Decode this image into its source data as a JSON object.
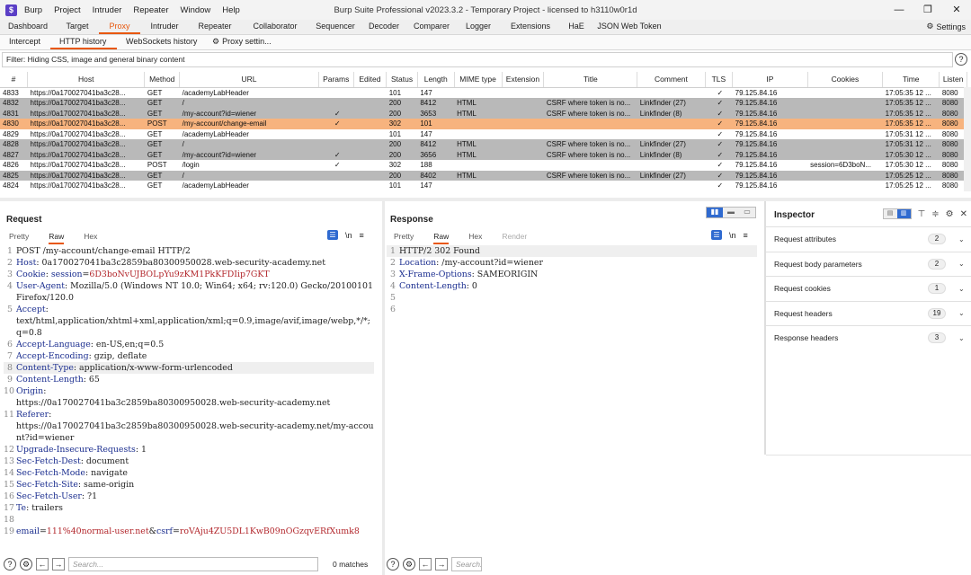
{
  "app": {
    "icon_letter": "$",
    "menu": [
      "Burp",
      "Project",
      "Intruder",
      "Repeater",
      "Window",
      "Help"
    ],
    "window_title": "Burp Suite Professional v2023.3.2 - Temporary Project - licensed to h3110w0r1d"
  },
  "main_tabs": [
    "Dashboard",
    "Target",
    "Proxy",
    "Intruder",
    "Repeater",
    "Collaborator",
    "Sequencer",
    "Decoder",
    "Comparer",
    "Logger",
    "Extensions",
    "HaE",
    "JSON Web Token"
  ],
  "main_tabs_active": "Proxy",
  "settings_label": "Settings",
  "proxy_tabs": [
    "Intercept",
    "HTTP history",
    "WebSockets history"
  ],
  "proxy_settings_label": "Proxy settin...",
  "filter_text": "Filter: Hiding CSS, image and general binary content",
  "history": {
    "columns": [
      "#",
      "Host",
      "Method",
      "URL",
      "Params",
      "Edited",
      "Status",
      "Length",
      "MIME type",
      "Extension",
      "Title",
      "Comment",
      "TLS",
      "IP",
      "Cookies",
      "Time",
      "Listen"
    ],
    "rows": [
      {
        "n": "4833",
        "host": "https://0a170027041ba3c28...",
        "method": "GET",
        "url": "/academyLabHeader",
        "params": "",
        "status": "101",
        "length": "147",
        "mime": "",
        "title": "",
        "comment": "",
        "tls": "✓",
        "ip": "79.125.84.16",
        "cookies": "",
        "time": "17:05:35 12 ...",
        "listen": "8080",
        "style": "white"
      },
      {
        "n": "4832",
        "host": "https://0a170027041ba3c28...",
        "method": "GET",
        "url": "/",
        "params": "",
        "status": "200",
        "length": "8412",
        "mime": "HTML",
        "title": "CSRF where token is no...",
        "comment": "Linkfinder (27)",
        "tls": "✓",
        "ip": "79.125.84.16",
        "cookies": "",
        "time": "17:05:35 12 ...",
        "listen": "8080",
        "style": "gray"
      },
      {
        "n": "4831",
        "host": "https://0a170027041ba3c28...",
        "method": "GET",
        "url": "/my-account?id=wiener",
        "params": "✓",
        "status": "200",
        "length": "3653",
        "mime": "HTML",
        "title": "CSRF where token is no...",
        "comment": "Linkfinder (8)",
        "tls": "✓",
        "ip": "79.125.84.16",
        "cookies": "",
        "time": "17:05:35 12 ...",
        "listen": "8080",
        "style": "gray"
      },
      {
        "n": "4830",
        "host": "https://0a170027041ba3c28...",
        "method": "POST",
        "url": "/my-account/change-email",
        "params": "✓",
        "status": "302",
        "length": "101",
        "mime": "",
        "title": "",
        "comment": "",
        "tls": "✓",
        "ip": "79.125.84.16",
        "cookies": "",
        "time": "17:05:35 12 ...",
        "listen": "8080",
        "style": "sel"
      },
      {
        "n": "4829",
        "host": "https://0a170027041ba3c28...",
        "method": "GET",
        "url": "/academyLabHeader",
        "params": "",
        "status": "101",
        "length": "147",
        "mime": "",
        "title": "",
        "comment": "",
        "tls": "✓",
        "ip": "79.125.84.16",
        "cookies": "",
        "time": "17:05:31 12 ...",
        "listen": "8080",
        "style": "white"
      },
      {
        "n": "4828",
        "host": "https://0a170027041ba3c28...",
        "method": "GET",
        "url": "/",
        "params": "",
        "status": "200",
        "length": "8412",
        "mime": "HTML",
        "title": "CSRF where token is no...",
        "comment": "Linkfinder (27)",
        "tls": "✓",
        "ip": "79.125.84.16",
        "cookies": "",
        "time": "17:05:31 12 ...",
        "listen": "8080",
        "style": "gray"
      },
      {
        "n": "4827",
        "host": "https://0a170027041ba3c28...",
        "method": "GET",
        "url": "/my-account?id=wiener",
        "params": "✓",
        "status": "200",
        "length": "3656",
        "mime": "HTML",
        "title": "CSRF where token is no...",
        "comment": "Linkfinder (8)",
        "tls": "✓",
        "ip": "79.125.84.16",
        "cookies": "",
        "time": "17:05:30 12 ...",
        "listen": "8080",
        "style": "gray"
      },
      {
        "n": "4826",
        "host": "https://0a170027041ba3c28...",
        "method": "POST",
        "url": "/login",
        "params": "✓",
        "status": "302",
        "length": "188",
        "mime": "",
        "title": "",
        "comment": "",
        "tls": "✓",
        "ip": "79.125.84.16",
        "cookies": "session=6D3boN...",
        "time": "17:05:30 12 ...",
        "listen": "8080",
        "style": "white"
      },
      {
        "n": "4825",
        "host": "https://0a170027041ba3c28...",
        "method": "GET",
        "url": "/",
        "params": "",
        "status": "200",
        "length": "8402",
        "mime": "HTML",
        "title": "CSRF where token is no...",
        "comment": "Linkfinder (27)",
        "tls": "✓",
        "ip": "79.125.84.16",
        "cookies": "",
        "time": "17:05:25 12 ...",
        "listen": "8080",
        "style": "gray"
      },
      {
        "n": "4824",
        "host": "https://0a170027041ba3c28...",
        "method": "GET",
        "url": "/academyLabHeader",
        "params": "",
        "status": "101",
        "length": "147",
        "mime": "",
        "title": "",
        "comment": "",
        "tls": "✓",
        "ip": "79.125.84.16",
        "cookies": "",
        "time": "17:05:25 12 ...",
        "listen": "8080",
        "style": "white"
      }
    ]
  },
  "request": {
    "title": "Request",
    "tabs": [
      "Pretty",
      "Raw",
      "Hex"
    ],
    "active_tab": "Raw",
    "lines": [
      {
        "n": "1",
        "parts": [
          {
            "t": "POST /my-account/change-email HTTP/2",
            "c": "hv"
          }
        ]
      },
      {
        "n": "2",
        "parts": [
          {
            "t": "Host",
            "c": "hk"
          },
          {
            "t": ": 0a170027041ba3c2859ba80300950028.web-security-academy.net",
            "c": "hv"
          }
        ]
      },
      {
        "n": "3",
        "parts": [
          {
            "t": "Cookie",
            "c": "hk"
          },
          {
            "t": ": ",
            "c": "hv"
          },
          {
            "t": "session",
            "c": "hk"
          },
          {
            "t": "=",
            "c": "hv"
          },
          {
            "t": "6D3boNvUJBOLpYu9zKM1PkKFDIip7GKT",
            "c": "hred"
          }
        ]
      },
      {
        "n": "4",
        "parts": [
          {
            "t": "User-Agent",
            "c": "hk"
          },
          {
            "t": ": Mozilla/5.0 (Windows NT 10.0; Win64; x64; rv:120.0) Gecko/20100101 Firefox/120.0",
            "c": "hv"
          }
        ]
      },
      {
        "n": "5",
        "parts": [
          {
            "t": "Accept",
            "c": "hk"
          },
          {
            "t": ":\ntext/html,application/xhtml+xml,application/xml;q=0.9,image/avif,image/webp,*/*;q=0.8",
            "c": "hv"
          }
        ]
      },
      {
        "n": "6",
        "parts": [
          {
            "t": "Accept-Language",
            "c": "hk"
          },
          {
            "t": ": en-US,en;q=0.5",
            "c": "hv"
          }
        ]
      },
      {
        "n": "7",
        "parts": [
          {
            "t": "Accept-Encoding",
            "c": "hk"
          },
          {
            "t": ": gzip, deflate",
            "c": "hv"
          }
        ]
      },
      {
        "n": "8",
        "hl": true,
        "parts": [
          {
            "t": "Content-Type",
            "c": "hk"
          },
          {
            "t": ": application/x-www-form-urlencoded",
            "c": "hv"
          }
        ]
      },
      {
        "n": "9",
        "parts": [
          {
            "t": "Content-Length",
            "c": "hk"
          },
          {
            "t": ": 65",
            "c": "hv"
          }
        ]
      },
      {
        "n": "10",
        "parts": [
          {
            "t": "Origin",
            "c": "hk"
          },
          {
            "t": ":\nhttps://0a170027041ba3c2859ba80300950028.web-security-academy.net",
            "c": "hv"
          }
        ]
      },
      {
        "n": "11",
        "parts": [
          {
            "t": "Referer",
            "c": "hk"
          },
          {
            "t": ":\nhttps://0a170027041ba3c2859ba80300950028.web-security-academy.net/my-account?id=wiener",
            "c": "hv"
          }
        ]
      },
      {
        "n": "12",
        "parts": [
          {
            "t": "Upgrade-Insecure-Requests",
            "c": "hk"
          },
          {
            "t": ": 1",
            "c": "hv"
          }
        ]
      },
      {
        "n": "13",
        "parts": [
          {
            "t": "Sec-Fetch-Dest",
            "c": "hk"
          },
          {
            "t": ": document",
            "c": "hv"
          }
        ]
      },
      {
        "n": "14",
        "parts": [
          {
            "t": "Sec-Fetch-Mode",
            "c": "hk"
          },
          {
            "t": ": navigate",
            "c": "hv"
          }
        ]
      },
      {
        "n": "15",
        "parts": [
          {
            "t": "Sec-Fetch-Site",
            "c": "hk"
          },
          {
            "t": ": same-origin",
            "c": "hv"
          }
        ]
      },
      {
        "n": "16",
        "parts": [
          {
            "t": "Sec-Fetch-User",
            "c": "hk"
          },
          {
            "t": ": ?1",
            "c": "hv"
          }
        ]
      },
      {
        "n": "17",
        "parts": [
          {
            "t": "Te",
            "c": "hk"
          },
          {
            "t": ": trailers",
            "c": "hv"
          }
        ]
      },
      {
        "n": "18",
        "parts": [
          {
            "t": "",
            "c": "hv"
          }
        ]
      },
      {
        "n": "19",
        "parts": [
          {
            "t": "email",
            "c": "pblue"
          },
          {
            "t": "=",
            "c": "hv"
          },
          {
            "t": "111%40normal-user.net",
            "c": "pred"
          },
          {
            "t": "&",
            "c": "hv"
          },
          {
            "t": "csrf",
            "c": "pblue"
          },
          {
            "t": "=",
            "c": "hv"
          },
          {
            "t": "roVAju4ZU5DL1KwB09nOGzqvERfXumk8",
            "c": "pred"
          }
        ]
      }
    ]
  },
  "response": {
    "title": "Response",
    "tabs": [
      "Pretty",
      "Raw",
      "Hex",
      "Render"
    ],
    "active_tab": "Raw",
    "lines": [
      {
        "n": "1",
        "hl": true,
        "parts": [
          {
            "t": "HTTP/2 302 Found",
            "c": "hv"
          }
        ]
      },
      {
        "n": "2",
        "parts": [
          {
            "t": "Location",
            "c": "hk"
          },
          {
            "t": ": /my-account?id=wiener",
            "c": "hv"
          }
        ]
      },
      {
        "n": "3",
        "parts": [
          {
            "t": "X-Frame-Options",
            "c": "hk"
          },
          {
            "t": ": SAMEORIGIN",
            "c": "hv"
          }
        ]
      },
      {
        "n": "4",
        "parts": [
          {
            "t": "Content-Length",
            "c": "hk"
          },
          {
            "t": ": 0",
            "c": "hv"
          }
        ]
      },
      {
        "n": "5",
        "parts": [
          {
            "t": "",
            "c": "hv"
          }
        ]
      },
      {
        "n": "6",
        "parts": [
          {
            "t": "",
            "c": "hv"
          }
        ]
      }
    ]
  },
  "inspector": {
    "title": "Inspector",
    "sections": [
      {
        "label": "Request attributes",
        "count": "2"
      },
      {
        "label": "Request body parameters",
        "count": "2"
      },
      {
        "label": "Request cookies",
        "count": "1"
      },
      {
        "label": "Request headers",
        "count": "19"
      },
      {
        "label": "Response headers",
        "count": "3"
      }
    ]
  },
  "request_search": {
    "placeholder": "Search...",
    "matches": "0 matches"
  },
  "response_search": {
    "placeholder": "Search..."
  },
  "colors": {
    "accent": "#e8570c",
    "selected_row": "#f7b37e",
    "highlight_row": "#b9b9b9",
    "toggle_blue": "#2f6ad0"
  }
}
